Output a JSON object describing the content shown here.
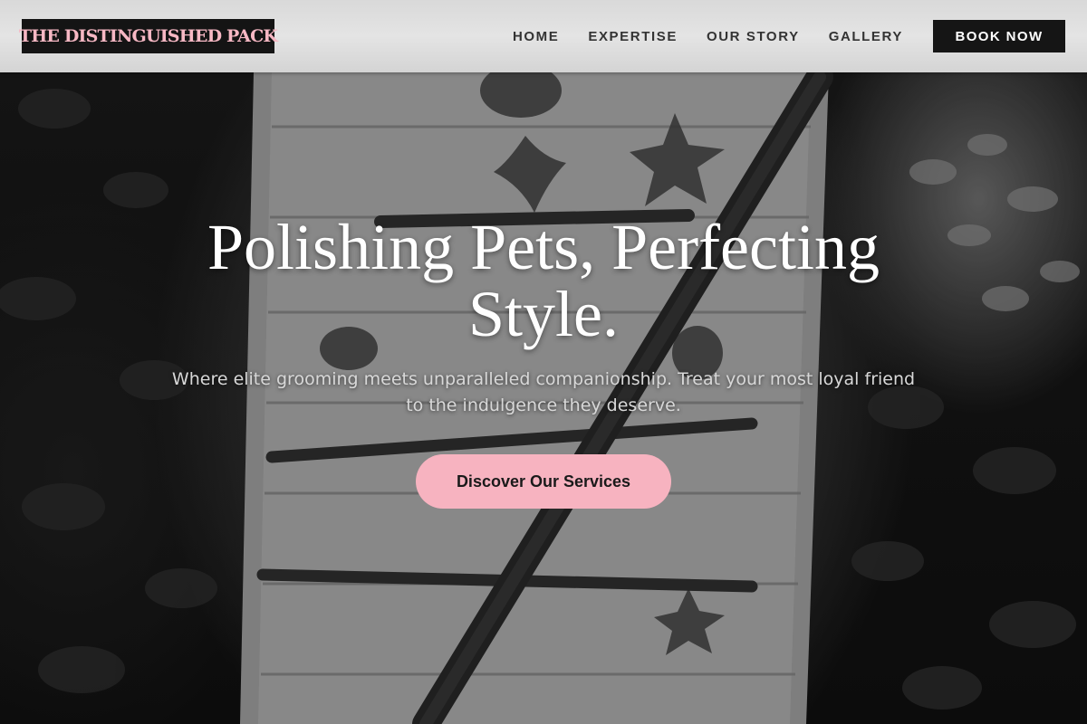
{
  "brand": {
    "name": "THE DISTINGUISHED PACK",
    "accent_color": "#f7b3c0",
    "dark_color": "#151515"
  },
  "nav": {
    "items": [
      {
        "label": "HOME"
      },
      {
        "label": "EXPERTISE"
      },
      {
        "label": "OUR STORY"
      },
      {
        "label": "GALLERY"
      }
    ],
    "cta_label": "BOOK NOW"
  },
  "hero": {
    "headline": "Polishing Pets, Perfecting Style.",
    "subheadline": "Where elite grooming meets unparalleled companionship. Treat your most loyal friend to the indulgence they deserve.",
    "cta_label": "Discover Our Services"
  }
}
